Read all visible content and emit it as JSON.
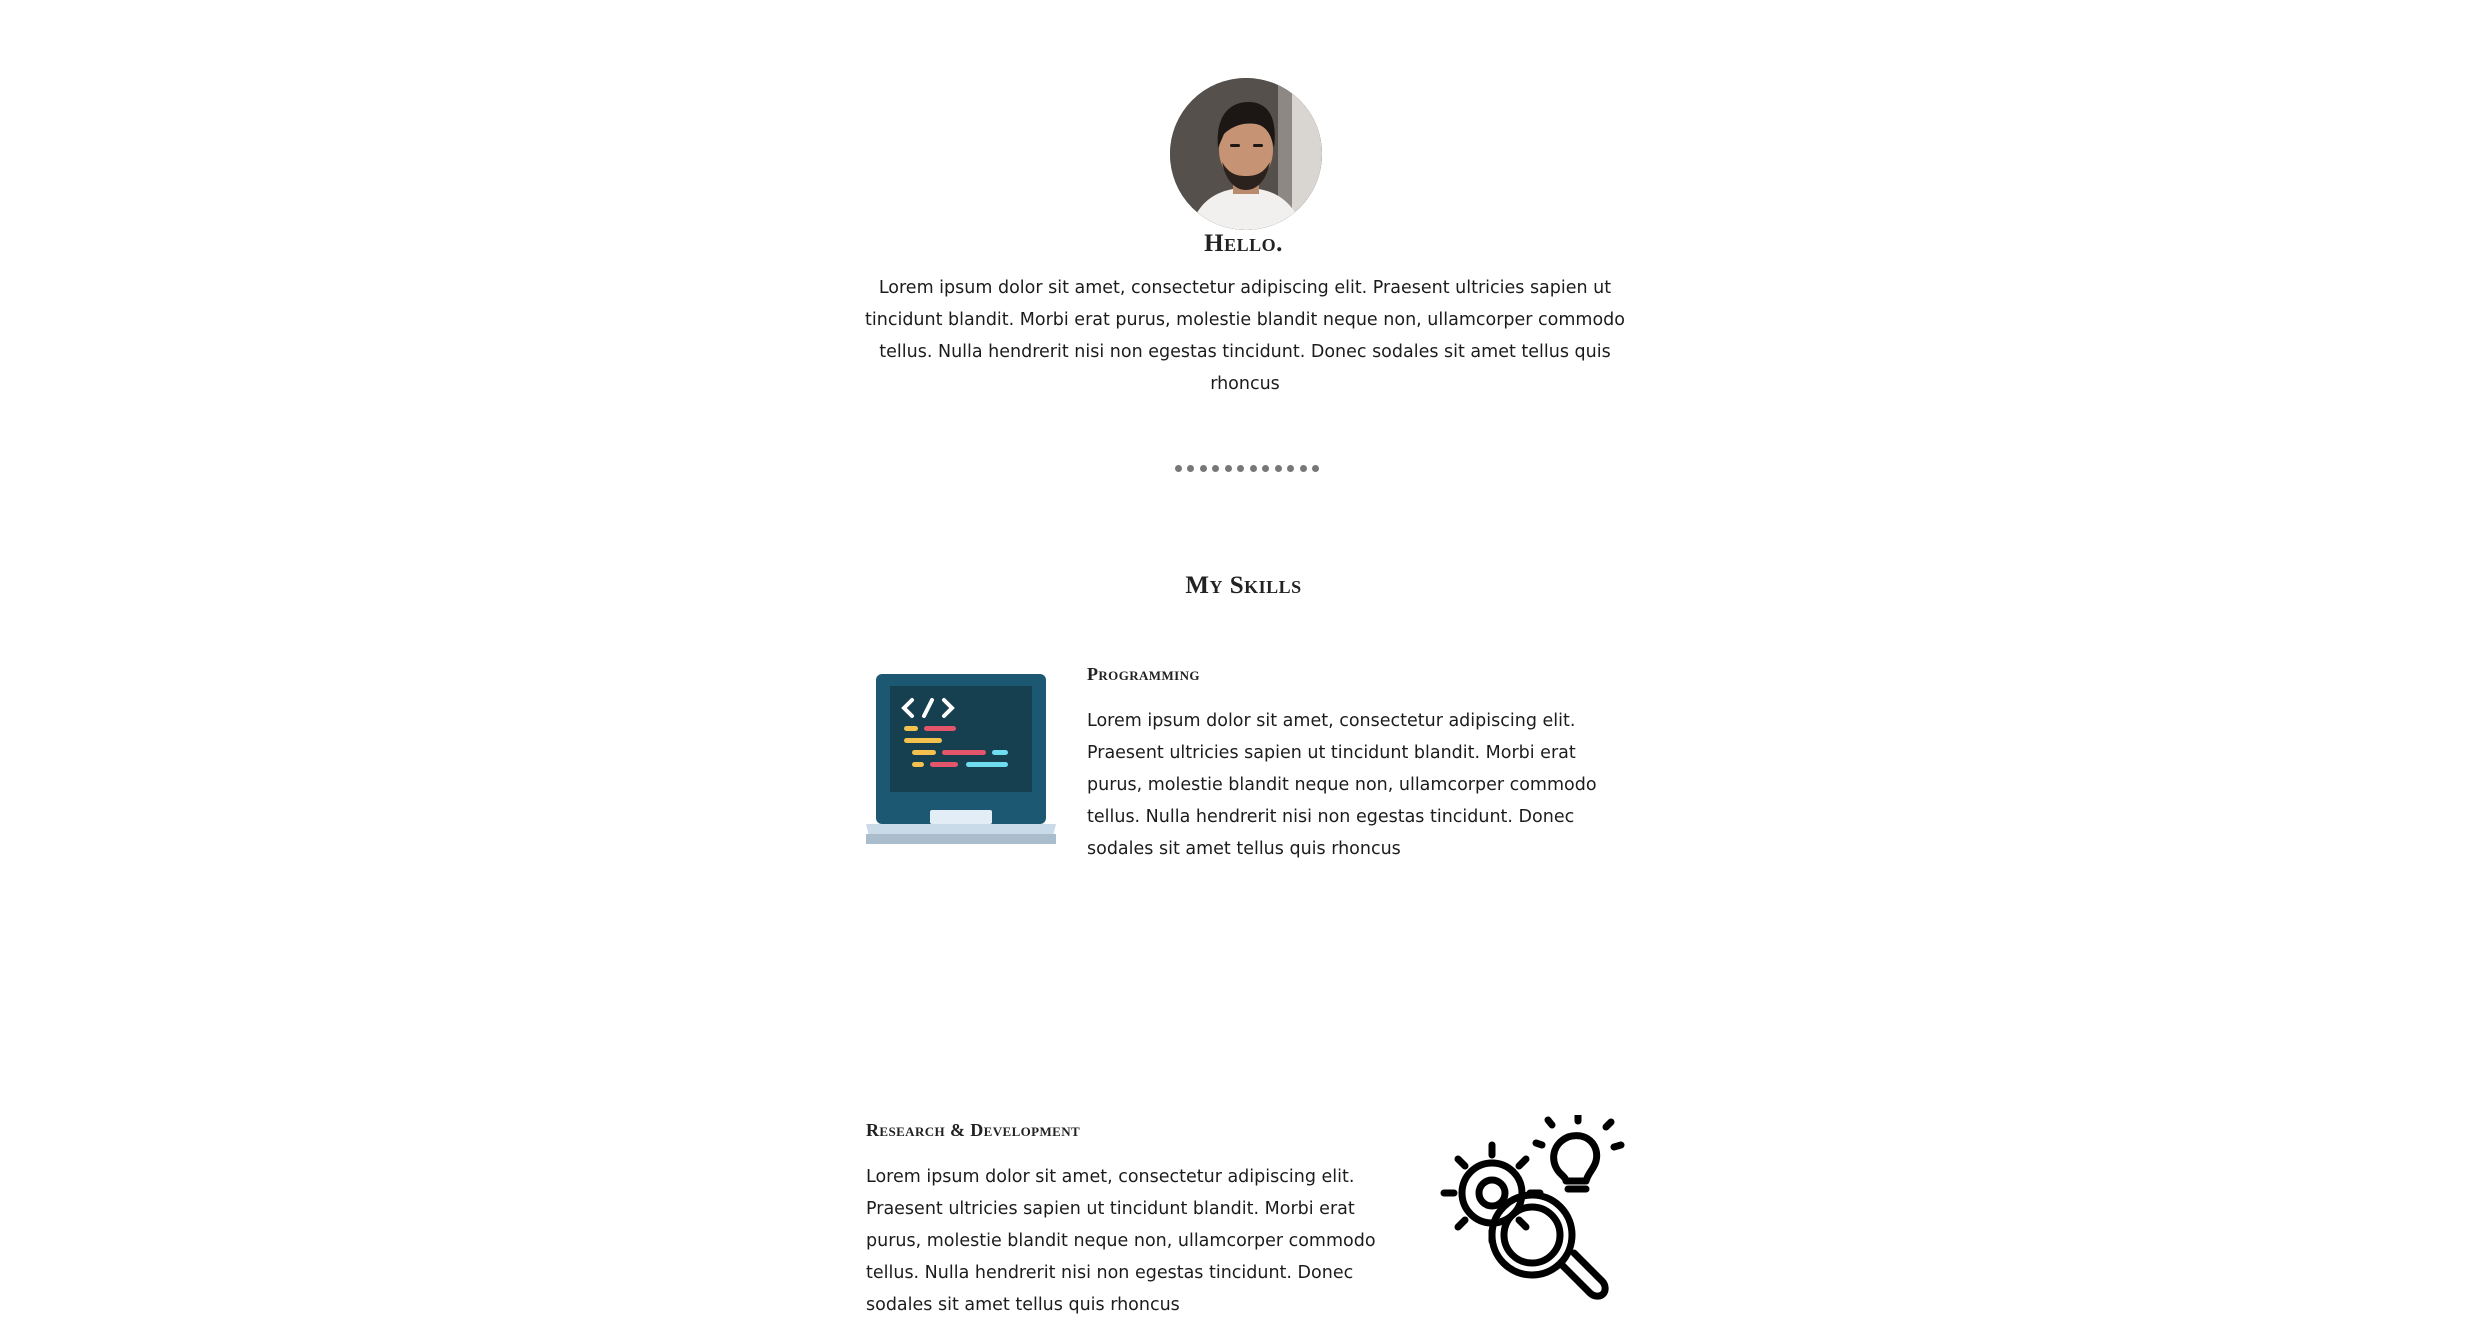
{
  "intro": {
    "greeting": "Hello.",
    "text": "Lorem ipsum dolor sit amet, consectetur adipiscing elit. Praesent ultricies sapien ut tincidunt blandit. Morbi erat purus, molestie blandit neque non, ullamcorper commodo tellus. Nulla hendrerit nisi non egestas tincidunt. Donec sodales sit amet tellus quis rhoncus"
  },
  "divider": {
    "dot_count": 12
  },
  "skills": {
    "title": "My Skills",
    "items": [
      {
        "heading": "Programming",
        "icon": "laptop-code-icon",
        "text": "Lorem ipsum dolor sit amet, consectetur adipiscing elit. Praesent ultricies sapien ut tincidunt blandit. Morbi erat purus, molestie blandit neque non, ullamcorper commodo tellus. Nulla hendrerit nisi non egestas tincidunt. Donec sodales sit amet tellus quis rhoncus"
      },
      {
        "heading": "Research & Development",
        "icon": "research-gears-icon",
        "text": "Lorem ipsum dolor sit amet, consectetur adipiscing elit. Praesent ultricies sapien ut tincidunt blandit. Morbi erat purus, molestie blandit neque non, ullamcorper commodo tellus. Nulla hendrerit nisi non egestas tincidunt. Donec sodales sit amet tellus quis rhoncus"
      }
    ]
  },
  "colors": {
    "laptop_frame": "#1d5873",
    "laptop_screen": "#163f4f",
    "laptop_base": "#c9dbe9",
    "code_yellow": "#f2c14e",
    "code_red": "#e3556b",
    "code_cyan": "#6fdcf0",
    "divider_dots": "#777777"
  }
}
